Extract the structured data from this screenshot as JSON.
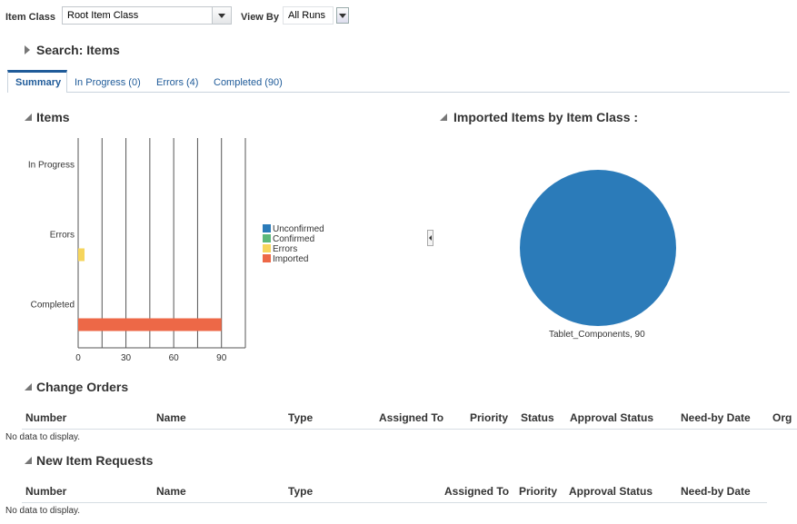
{
  "filters": {
    "item_class_label": "Item Class",
    "item_class_value": "Root Item Class",
    "view_by_label": "View By",
    "view_by_value": "All Runs"
  },
  "search": {
    "title": "Search: Items"
  },
  "tabs": [
    {
      "label": "Summary",
      "selected": true
    },
    {
      "label": "In Progress (0)"
    },
    {
      "label": "Errors (4)"
    },
    {
      "label": "Completed (90)"
    }
  ],
  "items_section": {
    "title": "Items"
  },
  "pie_section": {
    "title": "Imported Items by Item Class :"
  },
  "chart_data": [
    {
      "type": "bar",
      "orientation": "horizontal",
      "categories": [
        "In Progress",
        "Errors",
        "Completed"
      ],
      "series": [
        {
          "name": "Unconfirmed",
          "color": "#2b7bb9",
          "values": [
            0,
            0,
            0
          ]
        },
        {
          "name": "Confirmed",
          "color": "#5cb87a",
          "values": [
            0,
            0,
            0
          ]
        },
        {
          "name": "Errors",
          "color": "#f6d55c",
          "values": [
            0,
            4,
            0
          ]
        },
        {
          "name": "Imported",
          "color": "#ed6847",
          "values": [
            0,
            0,
            90
          ]
        }
      ],
      "x_ticks": [
        "0",
        "30",
        "60",
        "90"
      ],
      "xlim": [
        0,
        105
      ],
      "legend": "right",
      "grid": true
    },
    {
      "type": "pie",
      "slices": [
        {
          "label": "Tablet_Components",
          "value": 90,
          "color": "#2b7bb9"
        }
      ],
      "slice_label": "Tablet_Components, 90"
    }
  ],
  "change_orders": {
    "title": "Change Orders",
    "columns": [
      "Number",
      "Name",
      "Type",
      "Assigned To",
      "Priority",
      "Status",
      "Approval Status",
      "Need-by Date",
      "Org"
    ],
    "empty_text": "No data to display."
  },
  "new_item_requests": {
    "title": "New Item Requests",
    "columns": [
      "Number",
      "Name",
      "Type",
      "Assigned To",
      "Priority",
      "Approval Status",
      "Need-by Date"
    ],
    "empty_text": "No data to display."
  }
}
